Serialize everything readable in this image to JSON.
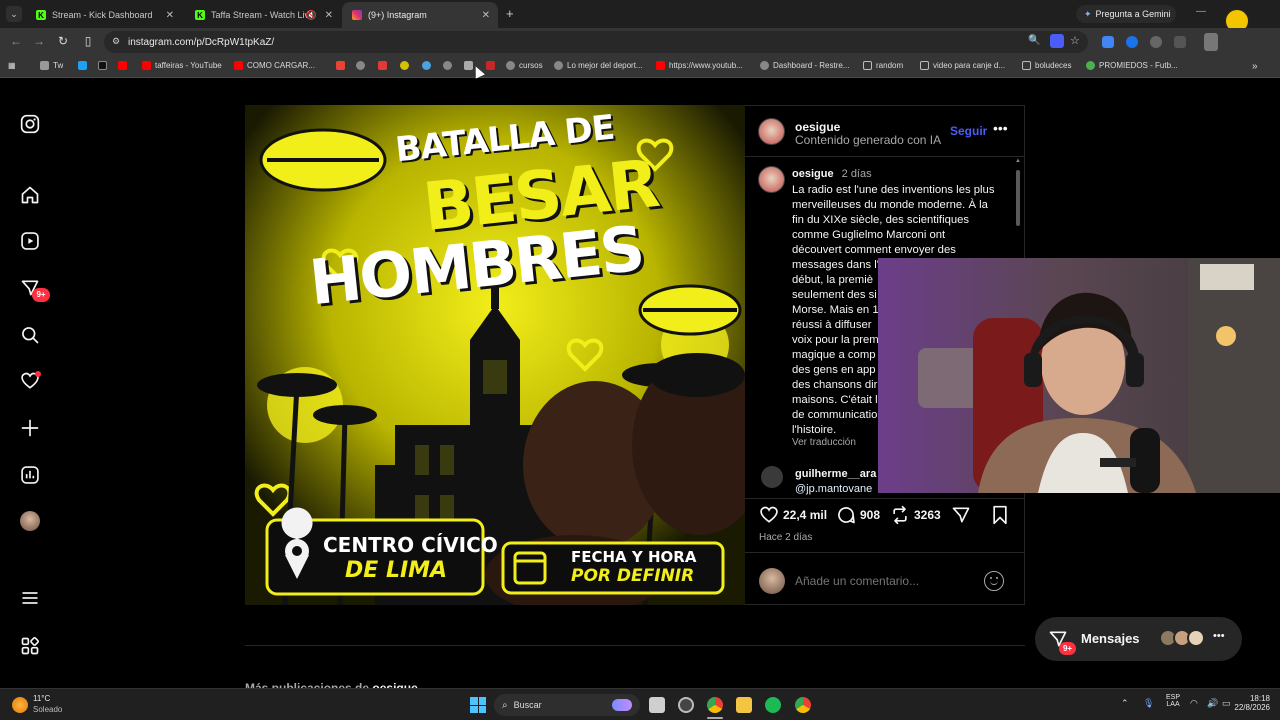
{
  "browser": {
    "tabs": [
      {
        "label": "Stream - Kick Dashboard",
        "active": false
      },
      {
        "label": "Taffa Stream - Watch Live o",
        "active": false
      },
      {
        "label": "(9+) Instagram",
        "active": true
      }
    ],
    "gemini_label": "Pregunta a Gemini",
    "url": "instagram.com/p/DcRpW1tpKaZ/",
    "bookmarks": [
      "Tw",
      "taffeiras - YouTube",
      "COMO CARGAR...",
      "cursos",
      "Lo mejor del deport...",
      "https://www.youtub...",
      "Dashboard - Restre...",
      "random",
      "video para canje d...",
      "boludeces",
      "PROMIEDOS - Futb..."
    ]
  },
  "sidebar": {
    "notifications_badge": "9+"
  },
  "post": {
    "image": {
      "line1": "BATALLA DE",
      "line2": "BESAR",
      "line3": "HOMBRES",
      "location_line1": "CENTRO CÍVICO",
      "location_line2": "DE LIMA",
      "date_line1": "FECHA Y HORA",
      "date_line2": "POR DEFINIR"
    },
    "author": "oesigue",
    "ai_label": "Contenido generado con IA",
    "follow_label": "Seguir",
    "caption_author": "oesigue",
    "caption_time": "2 días",
    "caption_lines": [
      "La radio est l'une des inventions les plus",
      "merveilleuses du monde moderne. À la",
      "fin du XIXe siècle, des scientifiques",
      "comme Guglielmo Marconi ont",
      "découvert comment envoyer des",
      "messages dans l'",
      "début, la premiè",
      "seulement des si",
      "Morse. Mais en 1",
      "réussi à diffuser",
      "voix pour la prem",
      "magique a comp",
      "des gens en app",
      "des chansons dir",
      "maisons. C'était l",
      "de communicatio",
      "l'histoire."
    ],
    "translate_label": "Ver traducción",
    "comment_user": "guilherme__ara",
    "comment_mention": "@jp.mantovane",
    "likes": "22,4 mil",
    "comments": "908",
    "reposts": "3263",
    "time_ago": "Hace 2 días",
    "add_comment_placeholder": "Añade un comentario...",
    "more_posts_label": "Más publicaciones de",
    "more_posts_user": "oesigue"
  },
  "messages": {
    "label": "Mensajes",
    "badge": "9+"
  },
  "taskbar": {
    "weather_temp": "11°C",
    "weather_desc": "Soleado",
    "search_label": "Buscar",
    "lang_line1": "ESP",
    "lang_line2": "LAA",
    "time": "18:18",
    "date": "22/8/2026"
  },
  "colors": {
    "accent_blue": "#4a5df9",
    "badge_red": "#ff3040",
    "poster_yellow": "#f2ee1a"
  }
}
